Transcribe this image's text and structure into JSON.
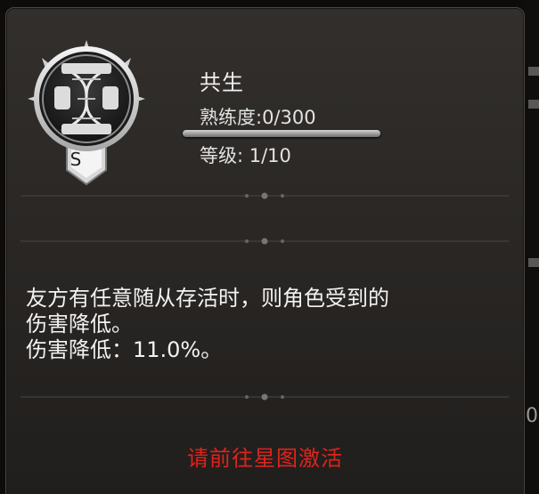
{
  "skill": {
    "name": "共生",
    "rank_letter": "S",
    "proficiency_text": "熟练度:0/300",
    "proficiency_progress": 0,
    "level_text": "等级: 1/10"
  },
  "description": {
    "line1": "友方有任意随从存活时，则角色受到的",
    "line2": "伤害降低。",
    "line3": "伤害降低：11.0%。"
  },
  "activate_label": "请前往星图激活",
  "side_digit": "0",
  "colors": {
    "activate_text": "#e0231c",
    "panel_bg": "#2a2725",
    "text": "#f2f2f2"
  },
  "icons": {
    "emblem": "dna-helix-emblem-icon"
  }
}
